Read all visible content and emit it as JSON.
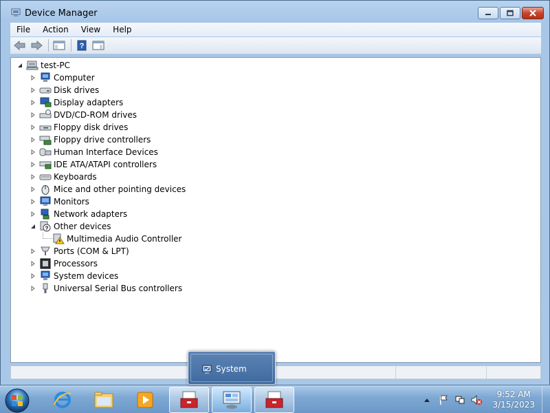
{
  "window": {
    "title": "Device Manager"
  },
  "menu": [
    "File",
    "Action",
    "View",
    "Help"
  ],
  "tree": {
    "root": "test-PC",
    "categories": [
      {
        "label": "Computer",
        "icon": "computer-icon"
      },
      {
        "label": "Disk drives",
        "icon": "disk-drive-icon"
      },
      {
        "label": "Display adapters",
        "icon": "display-adapter-icon"
      },
      {
        "label": "DVD/CD-ROM drives",
        "icon": "dvd-drive-icon"
      },
      {
        "label": "Floppy disk drives",
        "icon": "floppy-drive-icon"
      },
      {
        "label": "Floppy drive controllers",
        "icon": "floppy-controller-icon"
      },
      {
        "label": "Human Interface Devices",
        "icon": "hid-icon"
      },
      {
        "label": "IDE ATA/ATAPI controllers",
        "icon": "ide-controller-icon"
      },
      {
        "label": "Keyboards",
        "icon": "keyboard-icon"
      },
      {
        "label": "Mice and other pointing devices",
        "icon": "mouse-icon"
      },
      {
        "label": "Monitors",
        "icon": "monitor-icon"
      },
      {
        "label": "Network adapters",
        "icon": "network-adapter-icon"
      },
      {
        "label": "Other devices",
        "icon": "other-devices-icon",
        "expanded": true,
        "children": [
          {
            "label": "Multimedia Audio Controller",
            "icon": "warning-device-icon"
          }
        ]
      },
      {
        "label": "Ports (COM & LPT)",
        "icon": "port-icon"
      },
      {
        "label": "Processors",
        "icon": "processor-icon"
      },
      {
        "label": "System devices",
        "icon": "system-device-icon"
      },
      {
        "label": "Universal Serial Bus controllers",
        "icon": "usb-icon"
      }
    ]
  },
  "popup": {
    "label": "System"
  },
  "clock": {
    "time": "9:52 AM",
    "date": "3/15/2023"
  },
  "colors": {
    "accent": "#3f6a9f",
    "taskbar": "#7fa9d4",
    "window_frame": "#a9c7e7"
  }
}
